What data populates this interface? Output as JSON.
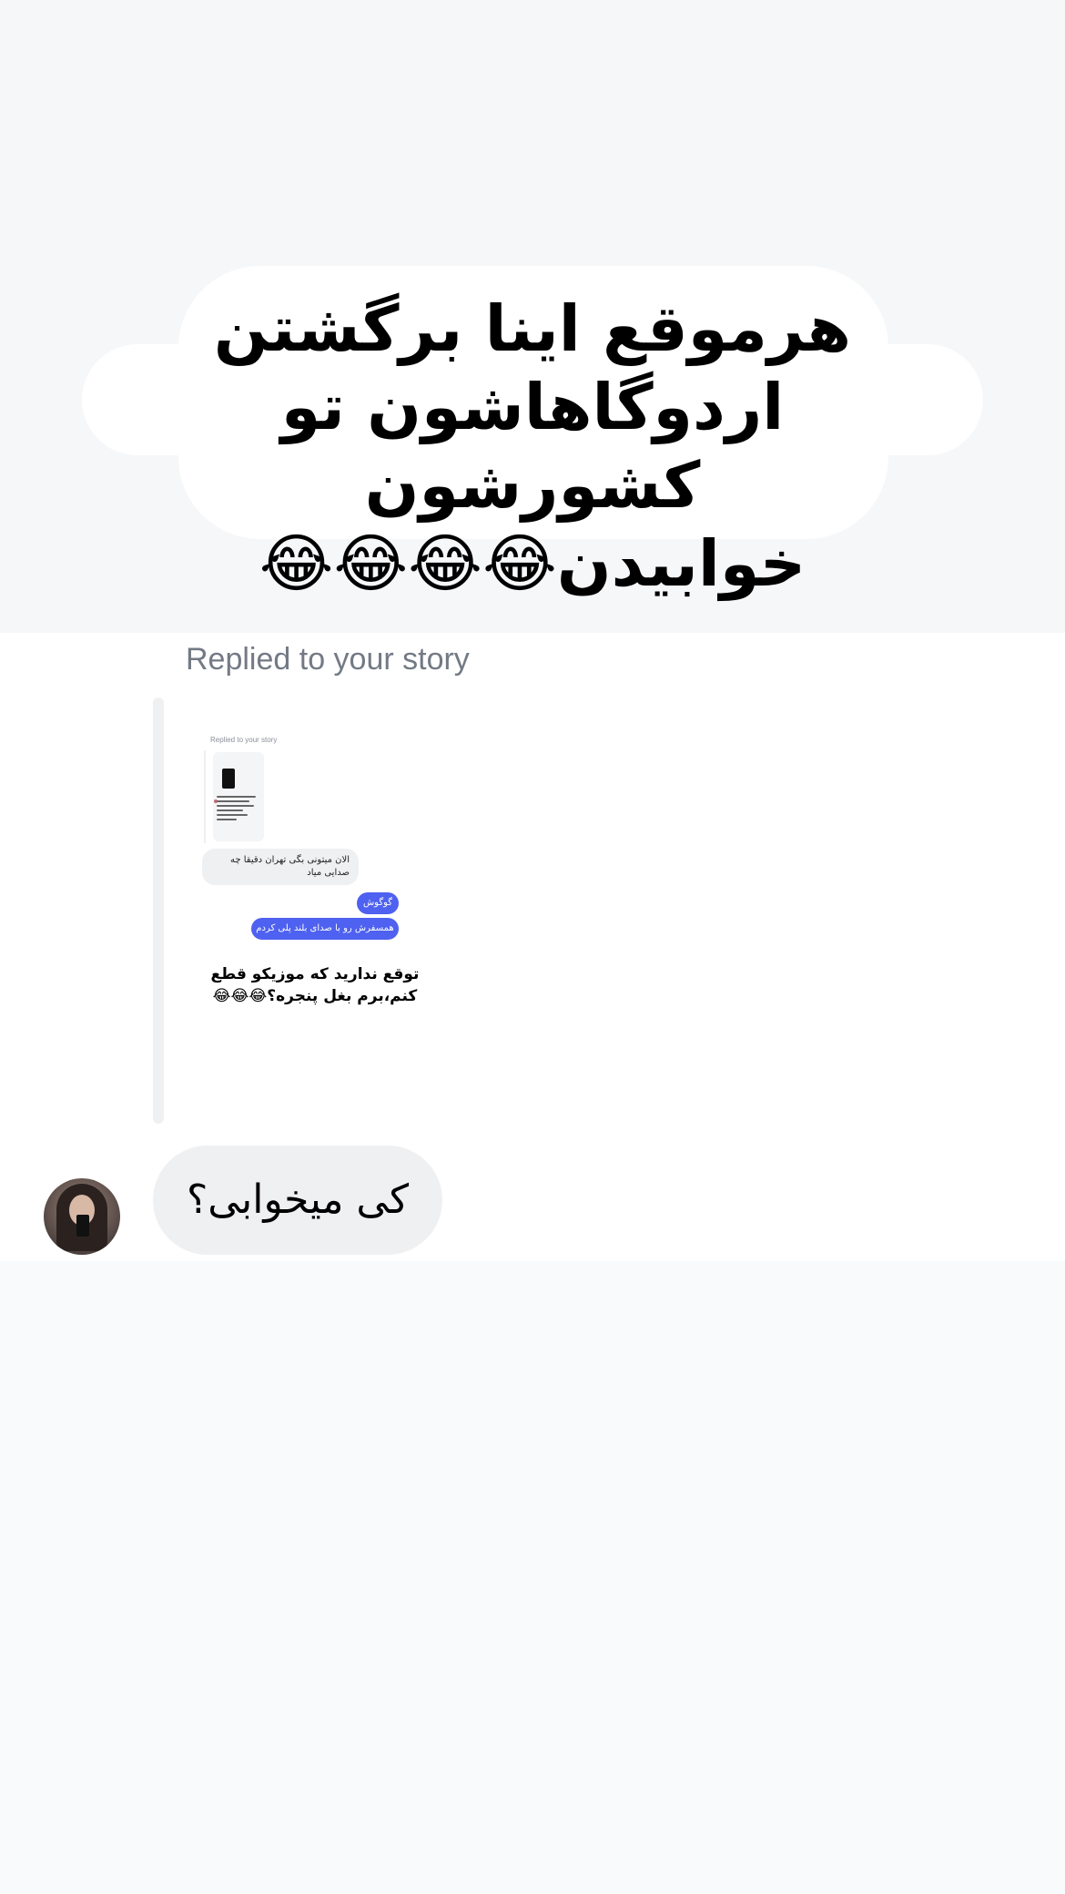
{
  "story_caption": {
    "lines": [
      "هرموقع اینا برگشتن",
      "اردوگاهاشون تو کشورشون",
      "خوابیدن😂😂😂😂"
    ]
  },
  "reply": {
    "label": "Replied to your story",
    "thumbnail": {
      "replied_label": "Replied to your story",
      "incoming_message": "الان میتونی بگی تهران دقیقا چه صدایی میاد",
      "outgoing_messages": [
        "گوگوش",
        "همسفرش رو با صدای بلند پلی کردم"
      ],
      "caption_lines": [
        "توقع ندارید که موزیکو قطع",
        "کنم،برم بغل پنجره؟😂😂😂"
      ]
    }
  },
  "message": {
    "text": "کی میخوابی؟"
  },
  "colors": {
    "accent": "#4e61f0",
    "bubble_bg": "#eff0f2",
    "label_gray": "#737a85"
  }
}
